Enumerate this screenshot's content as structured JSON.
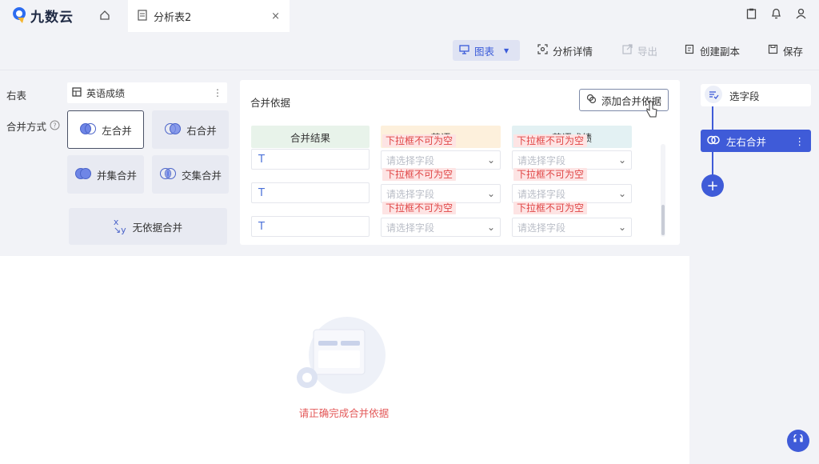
{
  "app": {
    "logo_text": "九数云"
  },
  "tabs": {
    "active_label": "分析表2",
    "close": "×"
  },
  "toolbar": {
    "chart": "图表",
    "analysis_detail": "分析详情",
    "export": "导出",
    "create_copy": "创建副本",
    "save": "保存"
  },
  "config": {
    "right_table_label": "右表",
    "right_table_value": "英语成绩",
    "join_mode_label": "合并方式",
    "join_modes": [
      "左合并",
      "右合并",
      "并集合并",
      "交集合并"
    ],
    "no_basis": "无依据合并"
  },
  "basis": {
    "title": "合并依据",
    "add_button": "添加合并依据",
    "columns": [
      "合并结果",
      "英语",
      "英语成绩"
    ],
    "row_type_icon": "T",
    "error_text": "下拉框不可为空",
    "placeholder": "请选择字段"
  },
  "preview": {
    "empty_text": "请正确完成合并依据"
  },
  "flow": {
    "select_fields": "选字段",
    "merge_node": "左右合并",
    "add": "+"
  },
  "colors": {
    "accent": "#3f5bd8",
    "error": "#e04545"
  }
}
